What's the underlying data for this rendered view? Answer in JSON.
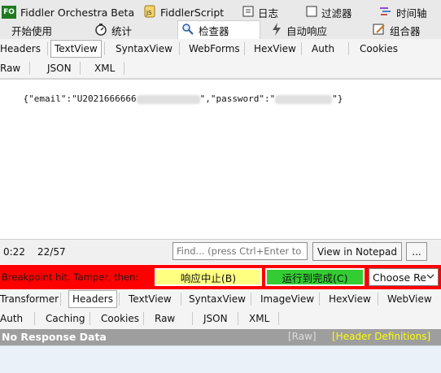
{
  "top_tabs_row1": [
    {
      "label": "Fiddler Orchestra Beta",
      "icon": "fo-logo"
    },
    {
      "label": "FiddlerScript",
      "icon": "script-icon"
    },
    {
      "label": "日志",
      "icon": "log-icon"
    },
    {
      "label": "过滤器",
      "icon": "checkbox-icon"
    },
    {
      "label": "时间轴",
      "icon": "timeline-icon"
    }
  ],
  "top_tabs_row2": [
    {
      "label": "开始使用"
    },
    {
      "label": "统计",
      "icon": "timer-icon"
    },
    {
      "label": "检查器",
      "icon": "inspect-icon"
    },
    {
      "label": "自动响应",
      "icon": "lightning-icon"
    },
    {
      "label": "组合器",
      "icon": "compose-icon"
    }
  ],
  "fo_logo_text": "FO",
  "request_tabs_row1": [
    "Headers",
    "TextView",
    "SyntaxView",
    "WebForms",
    "HexView",
    "Auth",
    "Cookies"
  ],
  "request_tabs_row2": [
    "Raw",
    "JSON",
    "XML"
  ],
  "request_body": {
    "part1": "{\"email\":\"U2021666666",
    "part2": "\",\"password\":\"",
    "part3": "\"}"
  },
  "status": {
    "position": "0:22",
    "count": "22/57",
    "find_placeholder": "Find... (press Ctrl+Enter to highlight all)",
    "view_notepad": "View in Notepad",
    "more": "..."
  },
  "breakpoint": {
    "text": "Breakpoint hit. Tamper, then:",
    "abort": "响应中止(B)",
    "run": "运行到完成(C)",
    "choose": "Choose Re"
  },
  "response_tabs_row1": [
    "Transformer",
    "Headers",
    "TextView",
    "SyntaxView",
    "ImageView",
    "HexView",
    "WebView"
  ],
  "response_tabs_row2": [
    "Auth",
    "Caching",
    "Cookies",
    "Raw",
    "JSON",
    "XML"
  ],
  "response_header": {
    "title": "No Response Data",
    "raw_link": "[Raw]",
    "defs_link": "[Header Definitions]"
  },
  "colors": {
    "breakpoint_red": "#ff0000",
    "abort_yellow": "#ffff80",
    "run_green": "#33cc33",
    "link_yellow": "#ffff00"
  }
}
